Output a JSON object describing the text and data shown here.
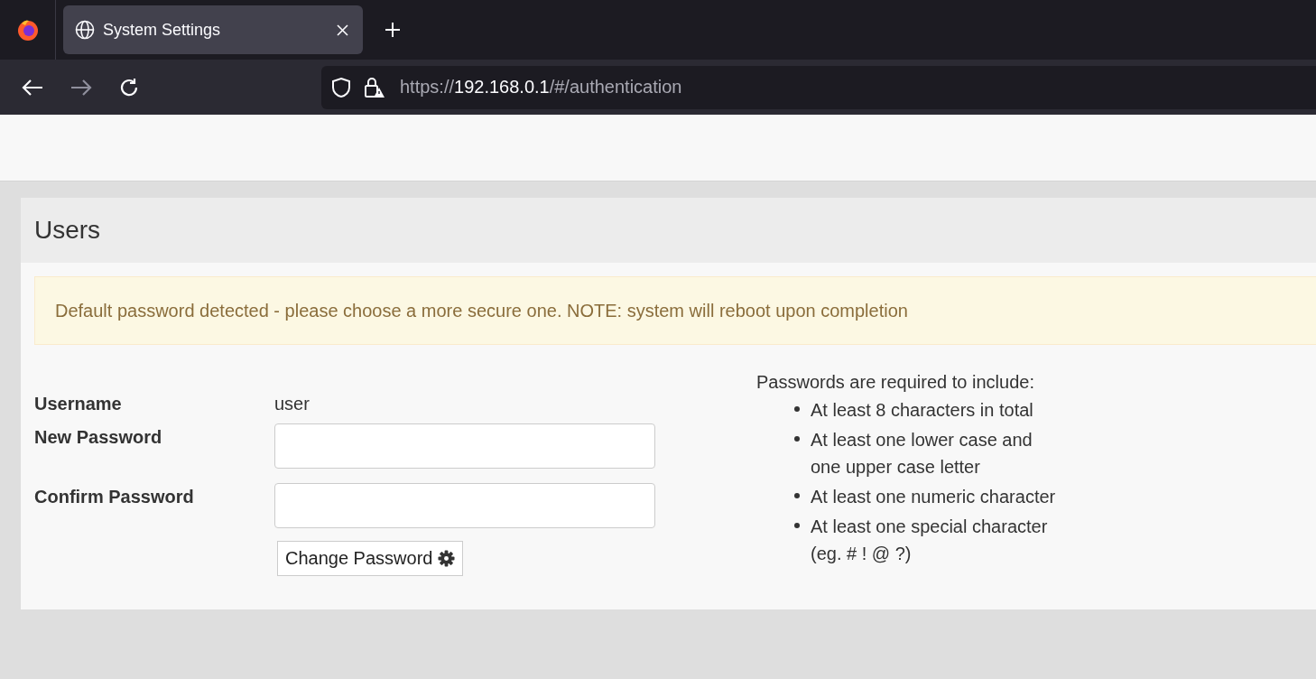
{
  "browser": {
    "tab": {
      "title": "System Settings",
      "selected": true
    },
    "address": {
      "scheme": "https://",
      "host": "192.168.0.1",
      "path": "/#/authentication"
    }
  },
  "panel": {
    "title": "Users",
    "alert": "Default password detected - please choose a more secure one. NOTE: system will reboot upon completion",
    "form": {
      "username_label": "Username",
      "username": "user",
      "new_password_label": "New Password",
      "confirm_password_label": "Confirm Password",
      "submit": "Change Password"
    },
    "requirements": {
      "heading": "Passwords are required to include:",
      "items": [
        "At least 8 characters in total",
        "At least one lower case and one upper case letter",
        "At least one numeric character",
        "At least one special character (eg. # ! @ ?)"
      ]
    }
  }
}
